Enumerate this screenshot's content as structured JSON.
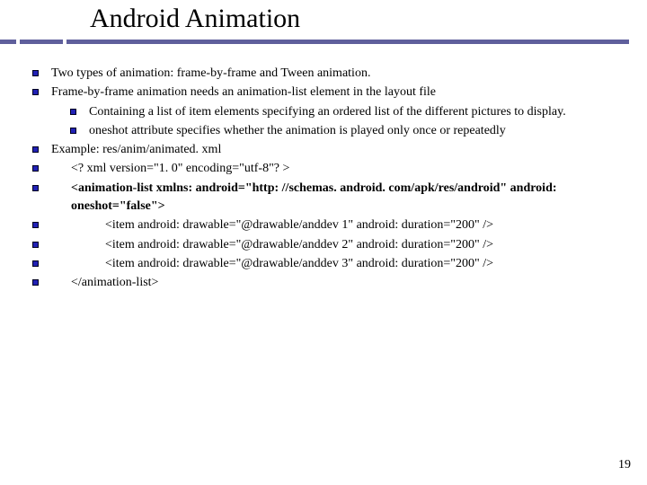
{
  "title": "Android Animation",
  "lines": {
    "l1": "Two types of animation: frame-by-frame and Tween animation.",
    "l2": "Frame-by-frame animation needs an animation-list element in the layout file",
    "l2a": "Containing a list of item elements specifying an ordered list of the different pictures to display.",
    "l2b_pre": "oneshot",
    "l2b_post": "  attribute specifies whether the animation is played only once or repeatedly",
    "l3": "Example: res/anim/animated. xml",
    "l4": "<? xml version=\"1. 0\" encoding=\"utf-8\"? >",
    "l5a": "<animation-list xmlns: android=\"http: //schemas. android. com/apk/res/android\" android: oneshot=\"false\">",
    "l6": "<item android: drawable=\"@drawable/anddev 1\" android: duration=\"200\" />",
    "l7": "<item android: drawable=\"@drawable/anddev 2\" android: duration=\"200\" />",
    "l8": "<item android: drawable=\"@drawable/anddev 3\" android: duration=\"200\" />",
    "l9": "</animation-list>"
  },
  "page_number": "19"
}
